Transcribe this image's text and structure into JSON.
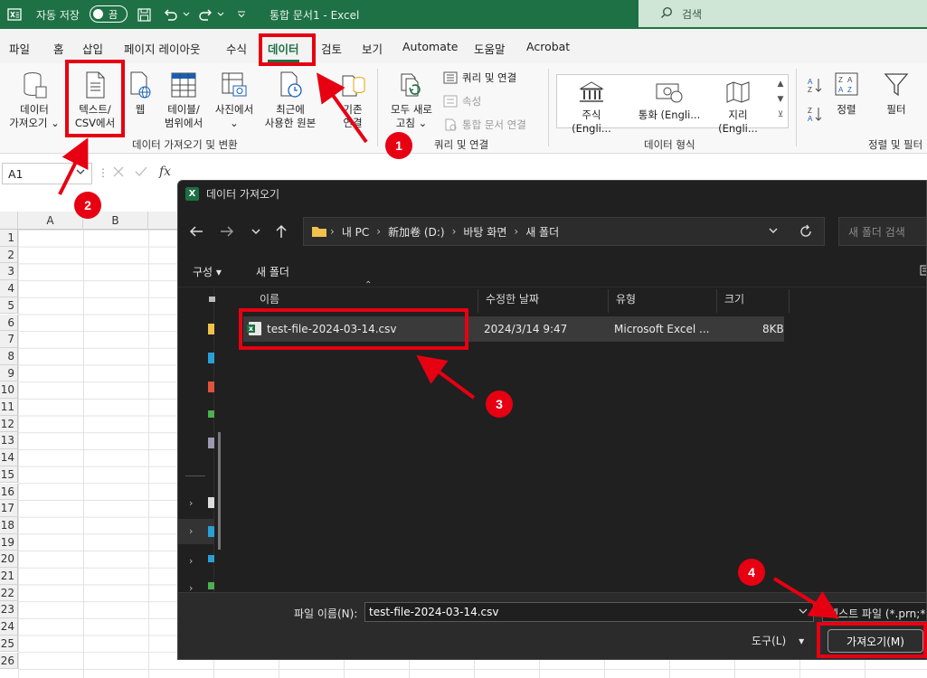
{
  "titlebar": {
    "autosave_label": "자동 저장",
    "autosave_state": "끔",
    "document_title": "통합 문서1 - Excel",
    "search_placeholder": "검색"
  },
  "tabs": [
    "파일",
    "홈",
    "삽입",
    "페이지 레이아웃",
    "수식",
    "데이터",
    "검토",
    "보기",
    "Automate",
    "도움말",
    "Acrobat"
  ],
  "active_tab": "데이터",
  "ribbon": {
    "get_data_line1": "데이터",
    "get_data_line2": "가져오기",
    "from_text_line1": "텍스트/",
    "from_text_line2": "CSV에서",
    "from_web": "웹",
    "from_table_line1": "테이블/",
    "from_table_line2": "범위에서",
    "from_picture": "사진에서",
    "recent_line1": "최근에",
    "recent_line2": "사용한 원본",
    "existing_line1": "기존",
    "existing_line2": "연결",
    "group_get_transform": "데이터 가져오기 및 변환",
    "refresh_line1": "모두 새로",
    "refresh_line2": "고침",
    "queries_connections": "쿼리 및 연결",
    "properties": "속성",
    "workbook_links": "통합 문서 연결",
    "group_queries": "쿼리 및 연결",
    "stocks": "주식 (Engli...",
    "currencies": "통화 (Engli...",
    "geography": "지리 (Engli...",
    "group_data_types": "데이터 형식",
    "sort": "정렬",
    "filter": "필터",
    "group_sort_filter": "정렬 및 필터"
  },
  "formula_bar": {
    "name_box": "A1",
    "fx": "fx"
  },
  "grid": {
    "columns": [
      "A",
      "B"
    ],
    "rows": [
      "1",
      "2",
      "3",
      "4",
      "5",
      "6",
      "7",
      "8",
      "9",
      "10",
      "11",
      "12",
      "13",
      "14",
      "15",
      "16",
      "17",
      "18",
      "19",
      "20",
      "21",
      "22",
      "23",
      "24",
      "25",
      "26"
    ]
  },
  "dialog": {
    "title": "데이터 가져오기",
    "breadcrumb": [
      "내 PC",
      "新加卷 (D:)",
      "바탕 화면",
      "새 폴더"
    ],
    "search_placeholder": "새 폴더 검색",
    "organize": "구성",
    "new_folder": "새 폴더",
    "columns": {
      "name": "이름",
      "modified": "수정한 날짜",
      "type": "유형",
      "size": "크기"
    },
    "files": [
      {
        "name": "test-file-2024-03-14.csv",
        "modified": "2024/3/14 9:47",
        "type": "Microsoft Excel ...",
        "size": "8KB"
      }
    ],
    "filename_label": "파일 이름(N):",
    "filename_value": "test-file-2024-03-14.csv",
    "filetype_value": "텍스트 파일 (*.prn;*.txt;*.csv)",
    "tools_label": "도구(L)",
    "import_button": "가져오기(M)"
  },
  "annotations": {
    "step1": "1",
    "step2": "2",
    "step3": "3",
    "step4": "4",
    "accent_color": "#e60012"
  }
}
